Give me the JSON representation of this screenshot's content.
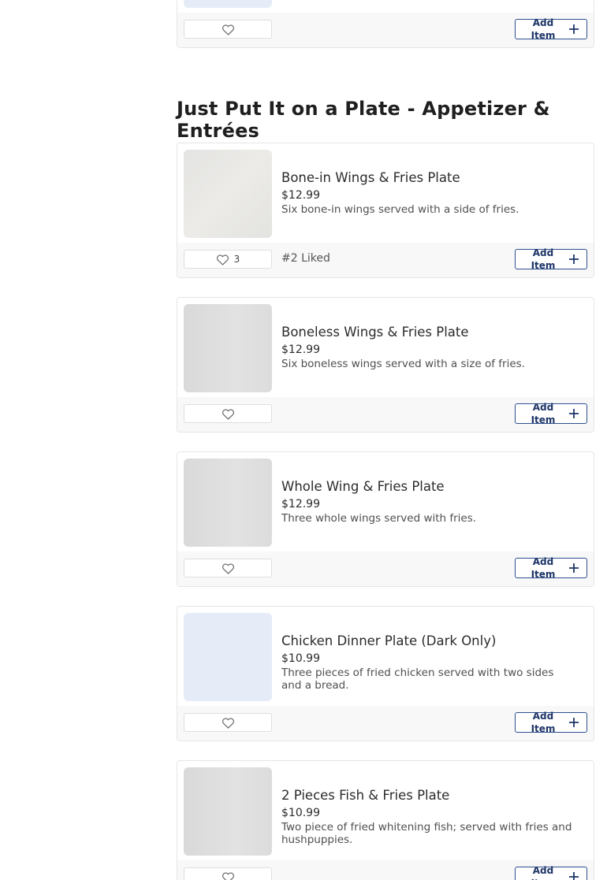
{
  "section": {
    "title": "Just Put It on a Plate - Appetizer & Entrées"
  },
  "add_label": "Add Item",
  "top_card": {
    "likes": ""
  },
  "items": [
    {
      "name": "Bone-in Wings & Fries Plate",
      "price": "$12.99",
      "description": "Six bone-in wings served with a side of fries.",
      "likes": "3",
      "rank": "#2 Liked"
    },
    {
      "name": "Boneless Wings & Fries Plate",
      "price": "$12.99",
      "description": "Six boneless wings served with a size of fries.",
      "likes": "",
      "rank": ""
    },
    {
      "name": "Whole Wing & Fries Plate",
      "price": "$12.99",
      "description": "Three whole wings served with fries.",
      "likes": "",
      "rank": ""
    },
    {
      "name": "Chicken Dinner Plate (Dark Only)",
      "price": "$10.99",
      "description": "Three pieces of fried chicken served with two sides and a bread.",
      "likes": "",
      "rank": ""
    },
    {
      "name": "2 Pieces Fish & Fries Plate",
      "price": "$10.99",
      "description": "Two piece of fried whitening fish; served with fries and hushpuppies.",
      "likes": "",
      "rank": ""
    }
  ],
  "icons": {
    "like": "heart-icon",
    "add": "plus-icon"
  },
  "colors": {
    "accent": "#2d4f8f",
    "footer_bg": "#f8f8f8"
  }
}
